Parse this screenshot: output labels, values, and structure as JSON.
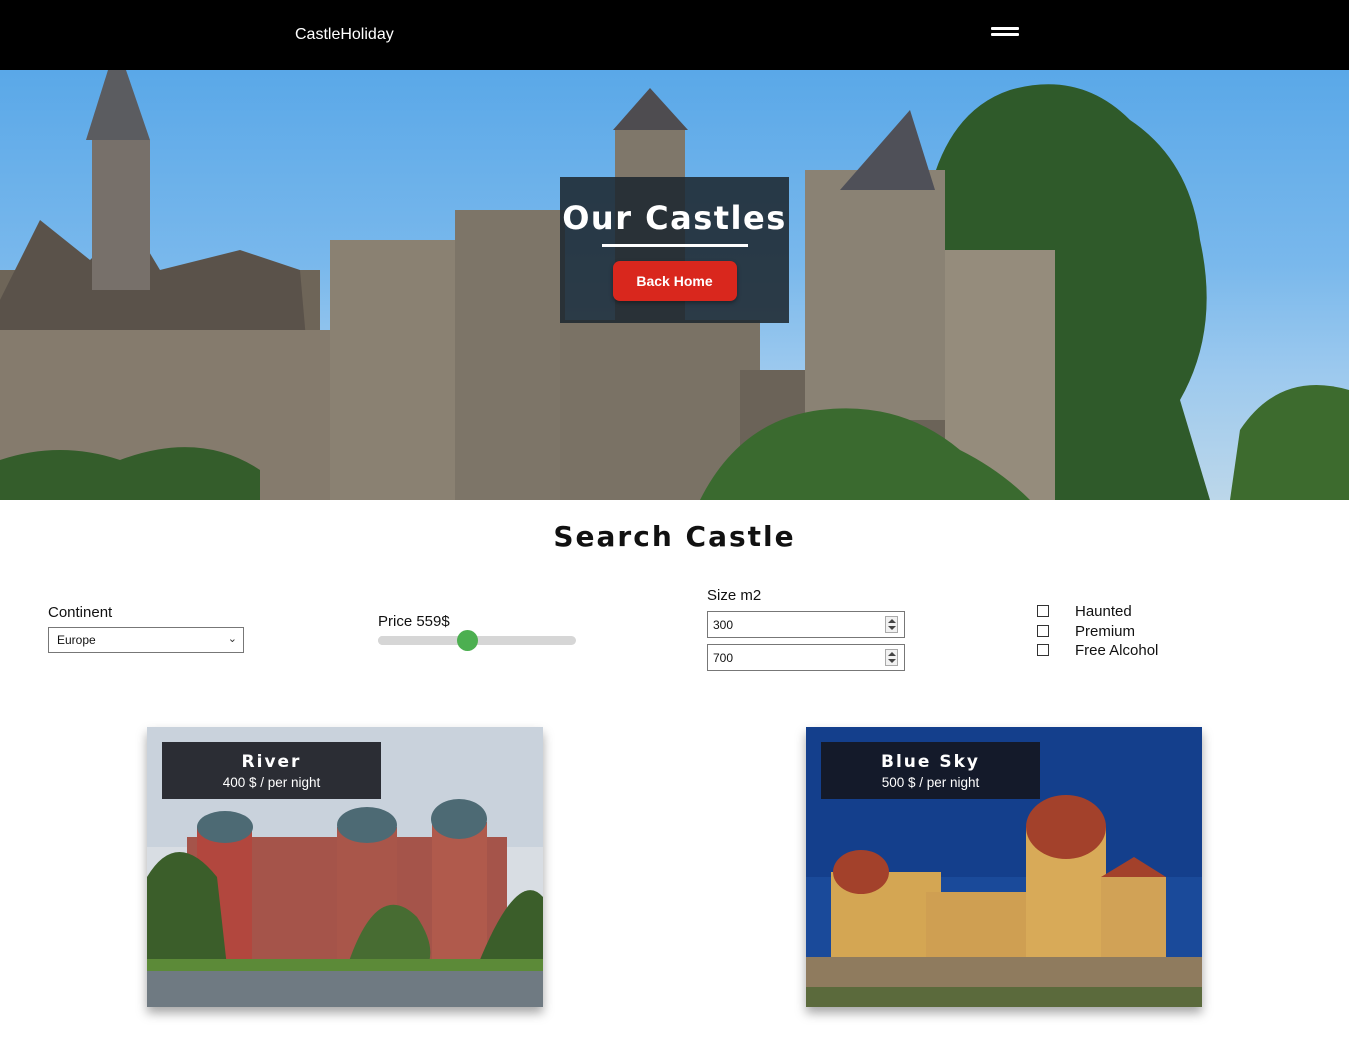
{
  "nav": {
    "brand": "CastleHoliday",
    "menu_icon": "hamburger-icon"
  },
  "hero": {
    "title": "Our Castles",
    "button_label": "Back Home"
  },
  "search": {
    "title": "Search Castle",
    "continent": {
      "label": "Continent",
      "selected": "Europe"
    },
    "price": {
      "label": "Price 559$",
      "fraction": 0.45
    },
    "size": {
      "label": "Size m2",
      "min_value": "300",
      "max_value": "700"
    },
    "filters": [
      "Haunted",
      "Premium",
      "Free Alcohol"
    ]
  },
  "castles": [
    {
      "name": "River",
      "price": "400 $ / per night"
    },
    {
      "name": "Blue Sky",
      "price": "500 $ / per night"
    }
  ],
  "colors": {
    "accent_red": "#d9271d",
    "slider_green": "#4caf50",
    "nav_bg": "#000000"
  }
}
